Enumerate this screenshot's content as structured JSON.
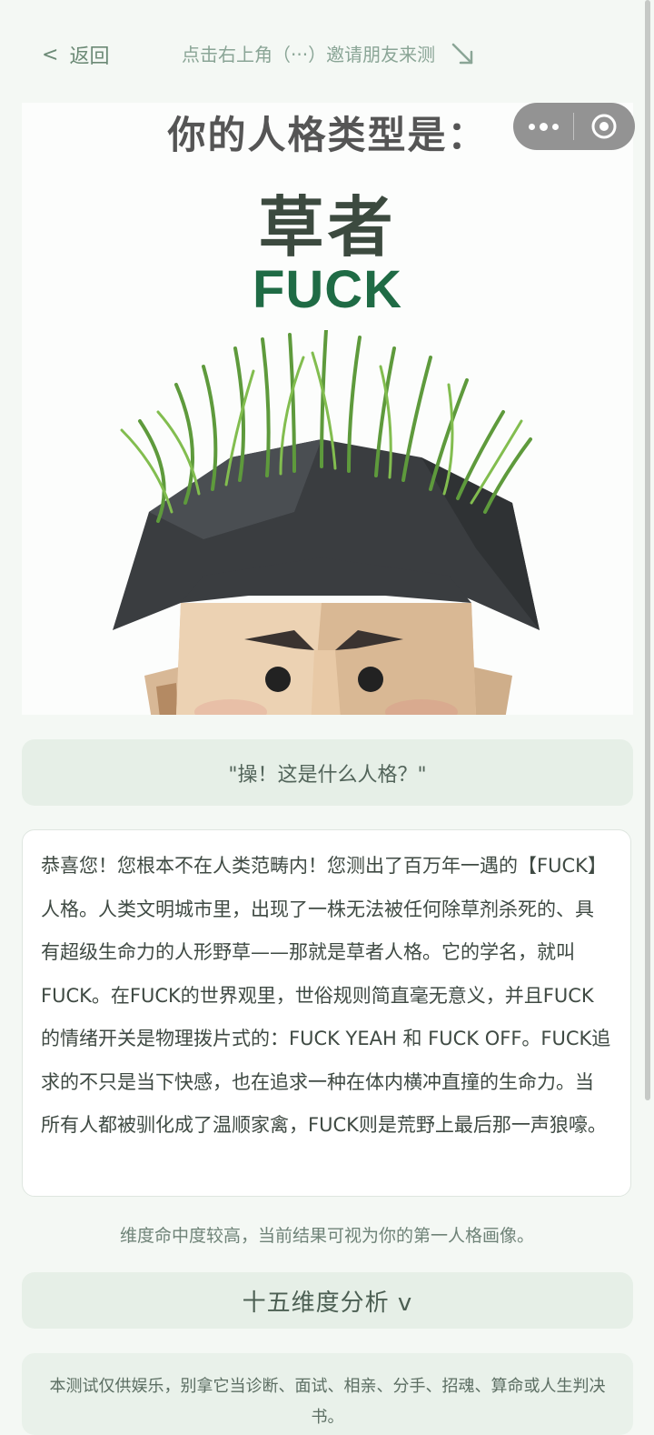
{
  "nav": {
    "back_chevron": "<",
    "back_label": "返回",
    "share_hint": "点击右上角（···）邀请朋友来测",
    "hint_arrow_icon": "arrow-down-right-icon"
  },
  "capsule": {
    "more_icon": "more-dots-icon",
    "close_icon": "record-target-icon"
  },
  "hero": {
    "heading": "你的人格类型是：",
    "type_name": "草者",
    "type_code": "FUCK",
    "illustration": "low-poly-man-with-grass-hair"
  },
  "quote": "\"操！这是什么人格？\"",
  "description": "恭喜您！您根本不在人类范畴内！您测出了百万年一遇的【FUCK】人格。人类文明城市里，出现了一株无法被任何除草剂杀死的、具有超级生命力的人形野草——那就是草者人格。它的学名，就叫 FUCK。在FUCK的世界观里，世俗规则简直毫无意义，并且FUCK的情绪开关是物理拨片式的：FUCK YEAH 和 FUCK OFF。FUCK追求的不只是当下快感，也在追求一种在体内横冲直撞的生命力。当所有人都被驯化成了温顺家禽，FUCK则是荒野上最后那一声狼嚎。",
  "match_note": "维度命中度较高，当前结果可视为你的第一人格画像。",
  "dimension_button": "十五维度分析 v",
  "disclaimer": "本测试仅供娱乐，别拿它当诊断、面试、相亲、分手、招魂、算命或人生判决书。",
  "colors": {
    "background": "#f4f8f4",
    "accent_green": "#1f6b45",
    "panel": "#e6efe7"
  }
}
